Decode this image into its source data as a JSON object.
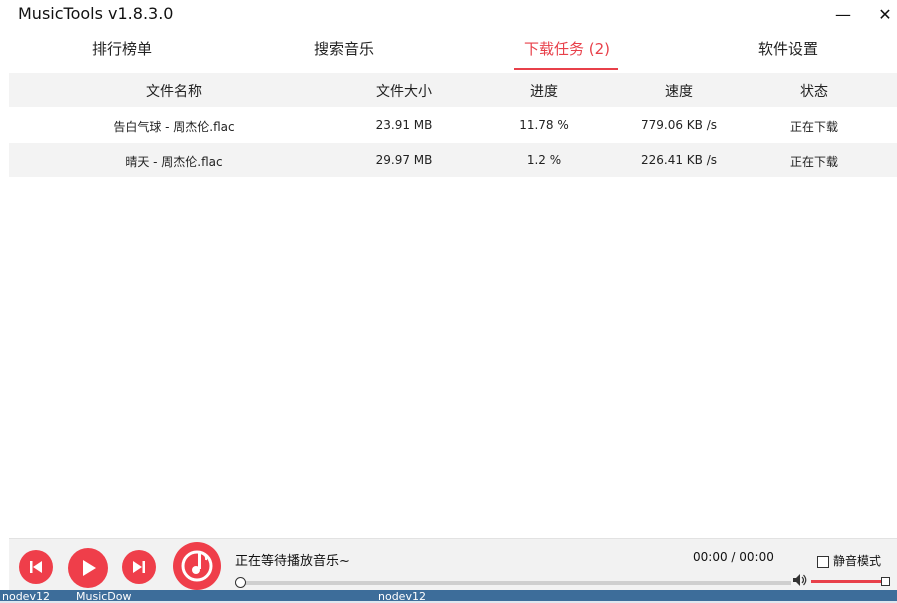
{
  "window": {
    "title": "MusicTools v1.8.3.0",
    "minimize_glyph": "—",
    "close_glyph": "✕"
  },
  "tabs": [
    {
      "label": "排行榜单"
    },
    {
      "label": "搜索音乐"
    },
    {
      "label": "下载任务 (2)",
      "active": true
    },
    {
      "label": "软件设置"
    }
  ],
  "table": {
    "columns": [
      "文件名称",
      "文件大小",
      "进度",
      "速度",
      "状态"
    ],
    "rows": [
      [
        "告白气球 - 周杰伦.flac",
        "23.91 MB",
        "11.78 %",
        "779.06 KB /s",
        "正在下载"
      ],
      [
        "晴天 - 周杰伦.flac",
        "29.97 MB",
        "1.2 %",
        "226.41 KB /s",
        "正在下载"
      ]
    ]
  },
  "player": {
    "now_playing": "正在等待播放音乐~",
    "time": "00:00 / 00:00",
    "mute_label": "静音模式",
    "progress_fraction": 0,
    "volume_fraction": 1.0,
    "icons": [
      "previous-icon",
      "play-icon",
      "next-icon",
      "music-note-icon",
      "volume-icon"
    ]
  },
  "taskbar": {
    "items": [
      "nodev12",
      "MusicDow",
      "nodev12"
    ]
  },
  "colors": {
    "accent": "#e8404a",
    "header_bg": "#f3f3f3",
    "player_bg": "#f2f2f2"
  }
}
